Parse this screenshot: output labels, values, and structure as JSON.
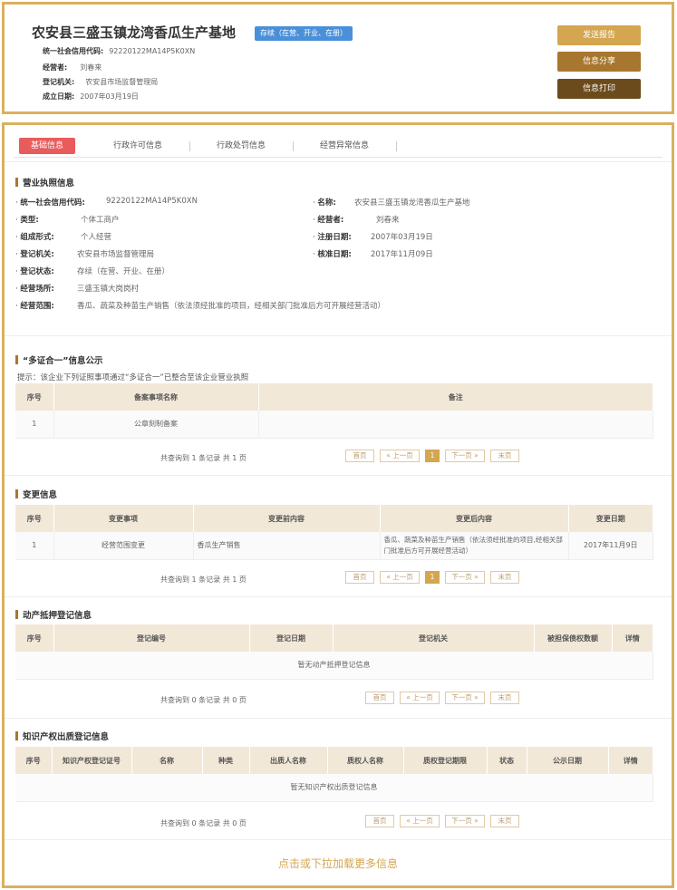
{
  "header": {
    "company_name": "农安县三盛玉镇龙湾香瓜生产基地",
    "status_tag": "存续（在营、开业、在册）",
    "rows": [
      {
        "label": "统一社会信用代码:",
        "value": "92220122MA14P5K0XN"
      },
      {
        "label": "经营者:",
        "value": "刘春来"
      },
      {
        "label": "登记机关:",
        "value": "农安县市场监督管理局"
      },
      {
        "label": "成立日期:",
        "value": "2007年03月19日"
      }
    ],
    "buttons": {
      "report": "发送报告",
      "share": "信息分享",
      "print": "信息打印"
    }
  },
  "tabs": [
    "基础信息",
    "行政许可信息",
    "行政处罚信息",
    "经营异常信息"
  ],
  "license": {
    "title": "营业执照信息",
    "left": [
      {
        "label": "统一社会信用代码:",
        "value": "92220122MA14P5K0XN"
      },
      {
        "label": "类型:",
        "value": "个体工商户"
      },
      {
        "label": "组成形式:",
        "value": "个人经营"
      },
      {
        "label": "登记机关:",
        "value": "农安县市场监督管理局"
      },
      {
        "label": "登记状态:",
        "value": "存续（在营、开业、在册）"
      },
      {
        "label": "经营场所:",
        "value": "三盛玉镇大岗岗村"
      },
      {
        "label": "经营范围:",
        "value": "香瓜、蔬菜及种苗生产销售（依法须经批准的项目，经相关部门批准后方可开展经营活动）"
      }
    ],
    "right": [
      {
        "label": "名称:",
        "value": "农安县三盛玉镇龙湾香瓜生产基地"
      },
      {
        "label": "经营者:",
        "value": "刘春来"
      },
      {
        "label": "注册日期:",
        "value": "2007年03月19日"
      },
      {
        "label": "核准日期:",
        "value": "2017年11月09日"
      }
    ]
  },
  "multi": {
    "title": "“多证合一”信息公示",
    "hint": "提示：该企业下列证照事项通过“多证合一”已整合至该企业营业执照",
    "headers": [
      "序号",
      "备案事项名称",
      "备注"
    ],
    "rows": [
      [
        "1",
        "公章刻制备案",
        ""
      ]
    ],
    "total": "共查询到 1 条记录 共 1 页"
  },
  "change": {
    "title": "变更信息",
    "headers": [
      "序号",
      "变更事项",
      "变更前内容",
      "变更后内容",
      "变更日期"
    ],
    "rows": [
      [
        "1",
        "经营范围变更",
        "香瓜生产销售",
        "香瓜、蔬菜及种苗生产销售（依法须经批准的项目,经相关部门批准后方可开展经营活动）",
        "2017年11月9日"
      ]
    ],
    "total": "共查询到 1 条记录 共 1 页"
  },
  "movable": {
    "title": "动产抵押登记信息",
    "headers": [
      "序号",
      "登记编号",
      "登记日期",
      "登记机关",
      "被担保债权数额",
      "详情"
    ],
    "empty": "暂无动产抵押登记信息",
    "total": "共查询到 0 条记录 共 0 页"
  },
  "ip": {
    "title": "知识产权出质登记信息",
    "headers": [
      "序号",
      "知识产权登记证号",
      "名称",
      "种类",
      "出质人名称",
      "质权人名称",
      "质权登记期限",
      "状态",
      "公示日期",
      "详情"
    ],
    "empty": "暂无知识产权出质登记信息",
    "total": "共查询到 0 条记录 共 0 页"
  },
  "pager": {
    "first": "首页",
    "prev": "« 上一页",
    "page": "1",
    "next": "下一页 »",
    "last": "末页"
  },
  "load_more": "点击或下拉加载更多信息"
}
